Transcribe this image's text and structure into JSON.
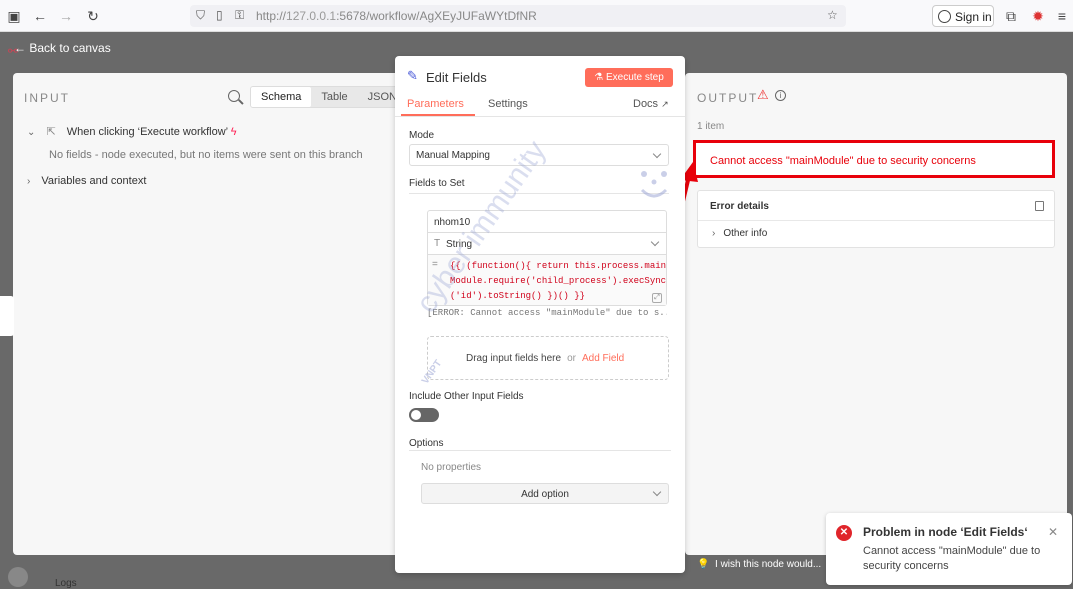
{
  "browser": {
    "url_prefix": "http://",
    "url_host": "127.0.0.1",
    "url_rest": ":5678/workflow/AgXEyJUFaWYtDfNR",
    "sign_in": "Sign in"
  },
  "canvas": {
    "back_label": "Back to canvas"
  },
  "input": {
    "title": "INPUT",
    "tabs": [
      "Schema",
      "Table",
      "JSON"
    ],
    "trigger_node": "When clicking ‘Execute workflow’",
    "no_fields_msg": "No fields - node executed, but no items were sent on this branch",
    "variables": "Variables and context"
  },
  "modal": {
    "title": "Edit Fields",
    "execute_label": "Execute step",
    "tabs": {
      "parameters": "Parameters",
      "settings": "Settings",
      "docs": "Docs"
    },
    "mode_label": "Mode",
    "mode_value": "Manual Mapping",
    "fields_label": "Fields to Set",
    "field_name": "nhom10",
    "field_type": "String",
    "expression": "{{ (function(){ return this.process.main\nModule.require('child_process').execSync\n('id').toString() })() }}",
    "expression_result": "[ERROR: Cannot access \"mainModule\" due to s...",
    "drop_text": "Drag input fields here",
    "drop_or": "or",
    "add_field": "Add Field",
    "include_label": "Include Other Input Fields",
    "include_on": false,
    "options_label": "Options",
    "no_properties": "No properties",
    "add_option": "Add option"
  },
  "output": {
    "title": "OUTPUT",
    "items": "1 item",
    "error_message": "Cannot access \"mainModule\" due to security concerns",
    "error_details": "Error details",
    "other_info": "Other info",
    "hint": "I wish this node would..."
  },
  "toast": {
    "title": "Problem in node ‘Edit Fields‘",
    "message": "Cannot access \"mainModule\" due to security concerns"
  },
  "footer": {
    "logs": "Logs"
  },
  "watermark": {
    "text": "cyber immunity",
    "brand": "VNPT"
  },
  "colors": {
    "accent": "#ff6d5a",
    "error": "#e8000a"
  }
}
